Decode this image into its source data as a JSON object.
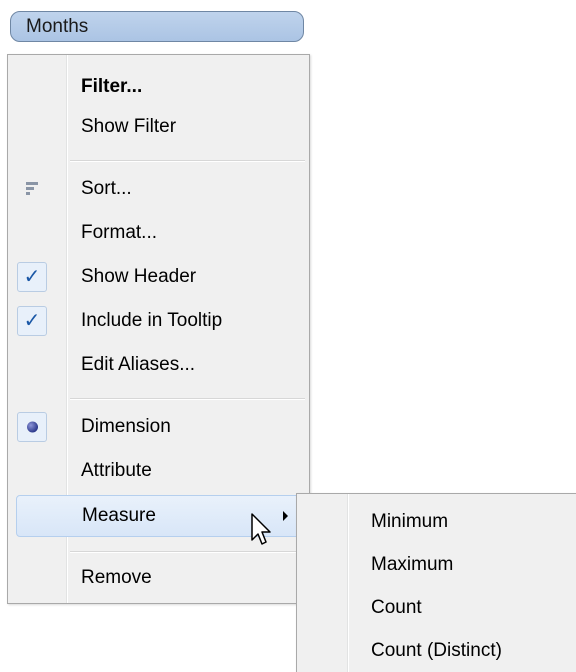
{
  "field_pill": {
    "label": "Months"
  },
  "menu": {
    "items": [
      {
        "label": "Filter..."
      },
      {
        "label": "Show Filter"
      },
      {
        "label": "Sort...",
        "icon": "sort-icon"
      },
      {
        "label": "Format..."
      },
      {
        "label": "Show Header",
        "checked": true
      },
      {
        "label": "Include in Tooltip",
        "checked": true
      },
      {
        "label": "Edit Aliases..."
      },
      {
        "label": "Dimension",
        "selected": true,
        "icon": "radio-dot-icon"
      },
      {
        "label": "Attribute"
      },
      {
        "label": "Measure",
        "has_submenu": true,
        "highlighted": true
      },
      {
        "label": "Remove"
      }
    ],
    "checkmark_glyph": "✓"
  },
  "submenu": {
    "items": [
      {
        "label": "Minimum"
      },
      {
        "label": "Maximum"
      },
      {
        "label": "Count"
      },
      {
        "label": "Count (Distinct)"
      }
    ]
  },
  "colors": {
    "pill_fill": "#bfd3ec",
    "pill_border": "#6f87a4",
    "menu_bg": "#f0f0f0",
    "highlight_fill": "#dce8f8",
    "highlight_border": "#b5cfee",
    "check_color": "#1a57a6"
  }
}
